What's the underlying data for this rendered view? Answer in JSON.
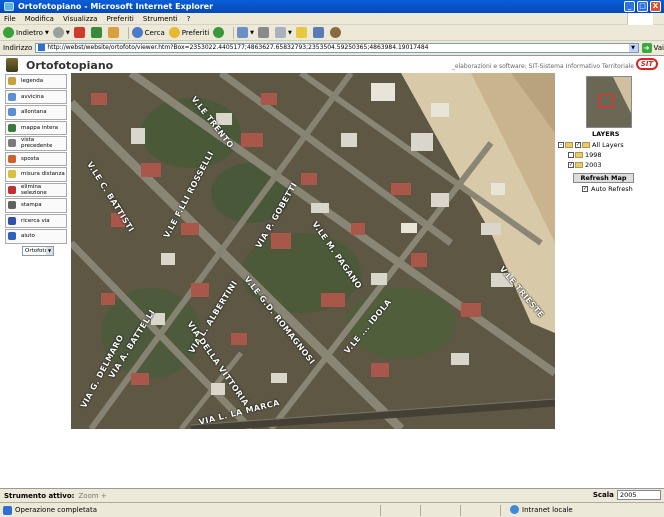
{
  "window": {
    "title": "Ortofotopiano - Microsoft Internet Explorer",
    "controls": [
      "_",
      "□",
      "X"
    ]
  },
  "menu": [
    "File",
    "Modifica",
    "Visualizza",
    "Preferiti",
    "Strumenti",
    "?"
  ],
  "toolbar": {
    "back": "Indietro",
    "search": "Cerca",
    "favorites": "Preferiti"
  },
  "address": {
    "label": "Indirizzo",
    "url": "http://webst/website/ortofoto/viewer.htm?Box=2353022.4405177;4863627.65832793;2353504.59250365;4863984.19017484",
    "go": "Vai"
  },
  "app": {
    "title": "Ortofotopiano",
    "credits": "_elaborazioni e software: SIT-Sistema Informativo Territoriale",
    "logo_text": "SIT"
  },
  "tools": [
    {
      "label": "legenda",
      "icon": "legend-icon",
      "color": "#c8a040"
    },
    {
      "label": "avvicina",
      "icon": "zoom-in-icon",
      "color": "#5b8fd0"
    },
    {
      "label": "allontana",
      "icon": "zoom-out-icon",
      "color": "#5b8fd0"
    },
    {
      "label": "mappa intera",
      "icon": "full-map-icon",
      "color": "#3a7a3a"
    },
    {
      "label": "vista precedente",
      "icon": "previous-view-icon",
      "color": "#7a7a7a"
    },
    {
      "label": "sposta",
      "icon": "pan-icon",
      "color": "#d06030"
    },
    {
      "label": "misura distanza",
      "icon": "measure-icon",
      "color": "#d8c040"
    },
    {
      "label": "elimina selezione",
      "icon": "clear-selection-icon",
      "color": "#c03030"
    },
    {
      "label": "stampa",
      "icon": "print-icon",
      "color": "#606060"
    },
    {
      "label": "ricerca via",
      "icon": "search-street-icon",
      "color": "#3050b0"
    },
    {
      "label": "aiuto",
      "icon": "help-icon",
      "color": "#3060c0"
    }
  ],
  "layer_select": {
    "value": "Ortofoto"
  },
  "map": {
    "streets": [
      "V.LE C. BATTISTI",
      "V.LE TRENTO",
      "V.LE F.LLI ROSSELLI",
      "VIA P. GOBETTI",
      "V.LE M. PAGANO",
      "V.LE G.D. ROMAGNOSI",
      "VIA L. ALBERTINI",
      "VIA DELLA VITTORIA",
      "VIA A. BATTELLI",
      "VIA G. DELMARO",
      "VIA L. LA MARCA",
      "V.LE TRIESTE",
      "V.LE ... IDOLA"
    ]
  },
  "layers": {
    "title": "LAYERS",
    "root": "All Layers",
    "items": [
      "1998",
      "2003"
    ],
    "refresh_button": "Refresh Map",
    "auto_refresh": "Auto Refresh"
  },
  "footer": {
    "tool_label": "Strumento attivo:",
    "tool_value": "Zoom +",
    "scale_label": "Scala 1:",
    "scale_value": "2005"
  },
  "status": {
    "text": "Operazione completata",
    "zone": "Intranet locale"
  }
}
